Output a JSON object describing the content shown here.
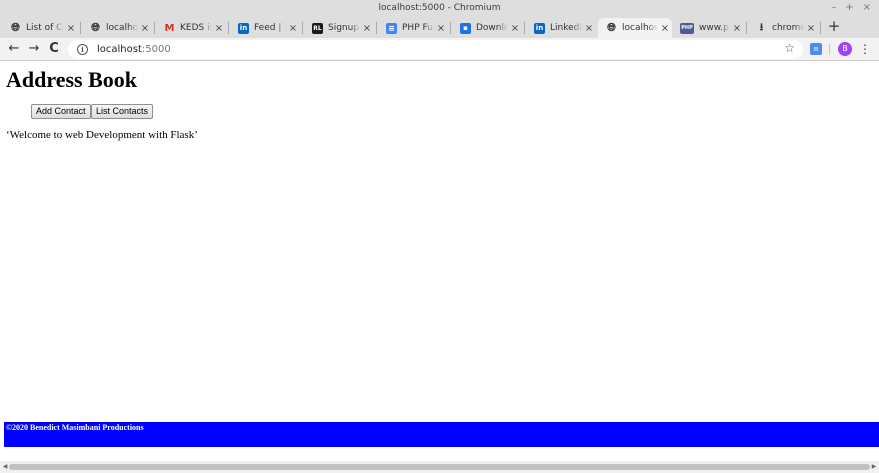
{
  "window": {
    "title": "localhost:5000 - Chromium",
    "controls": {
      "minimize": "–",
      "maximize": "+",
      "close": "×"
    }
  },
  "tabs": [
    {
      "title": "List of Co",
      "icon": "globe-icon",
      "active": false
    },
    {
      "title": "localhost",
      "icon": "globe-icon",
      "active": false
    },
    {
      "title": "KEDS is Hiring",
      "icon": "gmail-icon",
      "active": false
    },
    {
      "title": "Feed | LinkedIn",
      "icon": "linkedin-icon",
      "active": false
    },
    {
      "title": "Signup - Lo",
      "icon": "rl-icon",
      "active": false
    },
    {
      "title": "PHP Functions",
      "icon": "docs-icon",
      "active": false
    },
    {
      "title": "Downloads",
      "icon": "download-box-icon",
      "active": false
    },
    {
      "title": "LinkedIn",
      "icon": "linkedin-icon",
      "active": false
    },
    {
      "title": "localhost",
      "icon": "globe-icon",
      "active": true
    },
    {
      "title": "www.php.net",
      "icon": "php-icon",
      "active": false
    },
    {
      "title": "chrome://downloads",
      "icon": "download-icon",
      "active": false
    }
  ],
  "tab_close_glyph": "×",
  "new_tab_glyph": "+",
  "toolbar": {
    "back_glyph": "←",
    "forward_glyph": "→",
    "reload_glyph": "C",
    "url_host": "localhost",
    "url_port": ":5000",
    "info_glyph": "i",
    "star_glyph": "☆",
    "avatar_letter": "B",
    "menu_glyph": "⋮"
  },
  "page": {
    "title": "Address Book",
    "buttons": {
      "add_contact": "Add Contact",
      "list_contacts": "List Contacts"
    },
    "welcome": "‘Welcome to web Development with Flask’",
    "footer": "©2020 Benedict Masimbani Productions"
  },
  "colors": {
    "footer_bg": "#0000ff",
    "avatar_bg": "#a142f4",
    "extension_bg": "#4a8af4"
  }
}
